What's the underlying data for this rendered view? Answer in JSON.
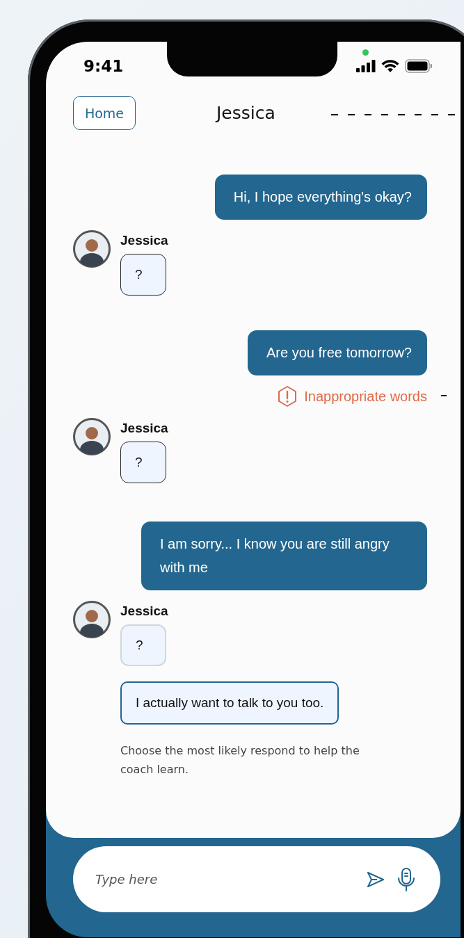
{
  "status_bar": {
    "time": "9:41"
  },
  "header": {
    "back_button": "Home",
    "title": "Jessica"
  },
  "messages": [
    {
      "kind": "sent",
      "text": "Hi, I hope everything's okay?"
    },
    {
      "kind": "received",
      "sender": "Jessica",
      "text": "?",
      "outlined": true
    },
    {
      "kind": "sent",
      "text": "Are you free tomorrow?",
      "warning": "Inappropriate words"
    },
    {
      "kind": "received",
      "sender": "Jessica",
      "text": "?",
      "outlined": true
    },
    {
      "kind": "sent",
      "text": "I am sorry... I know you are still angry with me"
    },
    {
      "kind": "received",
      "sender": "Jessica",
      "text": "?",
      "outlined": false
    }
  ],
  "suggestion": {
    "option": "I actually want to talk to you too.",
    "hint": "Choose the most likely respond to help the coach learn."
  },
  "composer": {
    "placeholder": "Type here"
  }
}
